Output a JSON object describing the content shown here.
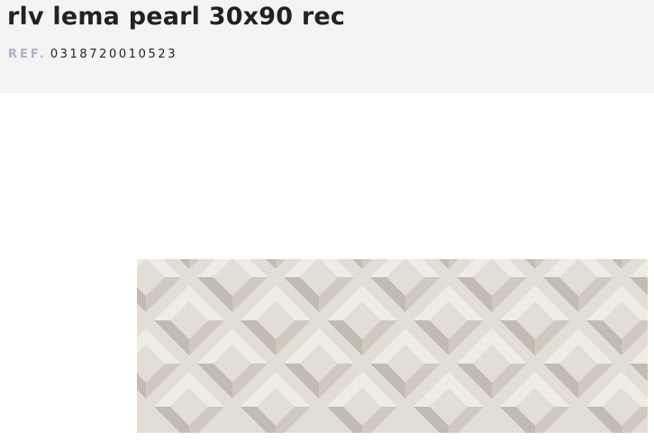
{
  "product": {
    "title": "rlv lema pearl 30x90 rec",
    "ref_label": "REF.",
    "ref_value": "0318720010523"
  },
  "image": {
    "name": "tile-product-image",
    "pattern": "3d-diamond-relief",
    "colors": {
      "base": "#e2ddd6",
      "light": "#efebe5",
      "shade": "#cfc9c0",
      "dark": "#c2bbb1"
    }
  }
}
